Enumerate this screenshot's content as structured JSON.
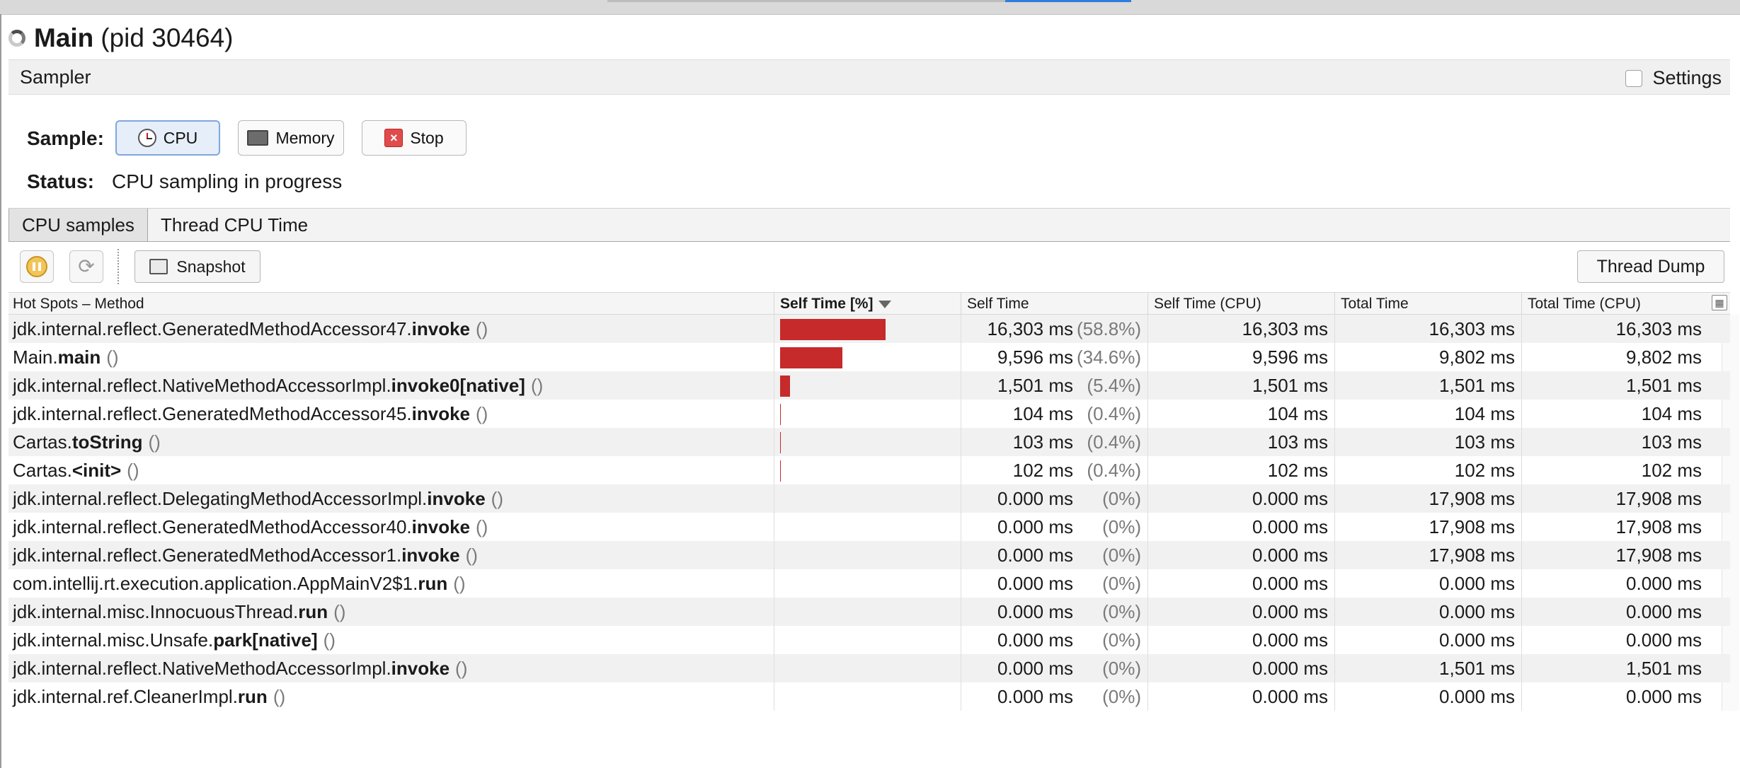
{
  "title": {
    "name": "Main",
    "pid": "(pid 30464)"
  },
  "sampler": {
    "label": "Sampler",
    "settings_label": "Settings"
  },
  "sample": {
    "label": "Sample:",
    "buttons": {
      "cpu": "CPU",
      "memory": "Memory",
      "stop": "Stop"
    },
    "status_label": "Status:",
    "status_value": "CPU sampling in progress"
  },
  "tabs": [
    "CPU samples",
    "Thread CPU Time"
  ],
  "toolbar": {
    "snapshot": "Snapshot",
    "thread_dump": "Thread Dump"
  },
  "table": {
    "columns": [
      "Hot Spots – Method",
      "Self Time [%]",
      "Self Time",
      "Self Time (CPU)",
      "Total Time",
      "Total Time (CPU)"
    ],
    "rows": [
      {
        "prefix": "jdk.internal.reflect.GeneratedMethodAccessor47.",
        "method": "invoke",
        "paren": "()",
        "self_pct": 58.8,
        "self_time": "16,303 ms",
        "pct_label": "(58.8%)",
        "self_cpu": "16,303 ms",
        "total": "16,303 ms",
        "total_cpu": "16,303 ms"
      },
      {
        "prefix": "Main.",
        "method": "main",
        "paren": "()",
        "self_pct": 34.6,
        "self_time": "9,596 ms",
        "pct_label": "(34.6%)",
        "self_cpu": "9,596 ms",
        "total": "9,802 ms",
        "total_cpu": "9,802 ms"
      },
      {
        "prefix": "jdk.internal.reflect.NativeMethodAccessorImpl.",
        "method": "invoke0[native]",
        "paren": "()",
        "self_pct": 5.4,
        "self_time": "1,501 ms",
        "pct_label": "(5.4%)",
        "self_cpu": "1,501 ms",
        "total": "1,501 ms",
        "total_cpu": "1,501 ms"
      },
      {
        "prefix": "jdk.internal.reflect.GeneratedMethodAccessor45.",
        "method": "invoke",
        "paren": "()",
        "self_pct": 0.4,
        "self_time": "104 ms",
        "pct_label": "(0.4%)",
        "self_cpu": "104 ms",
        "total": "104 ms",
        "total_cpu": "104 ms"
      },
      {
        "prefix": "Cartas.",
        "method": "toString",
        "paren": "()",
        "self_pct": 0.4,
        "self_time": "103 ms",
        "pct_label": "(0.4%)",
        "self_cpu": "103 ms",
        "total": "103 ms",
        "total_cpu": "103 ms"
      },
      {
        "prefix": "Cartas.",
        "method": "<init>",
        "paren": "()",
        "self_pct": 0.4,
        "self_time": "102 ms",
        "pct_label": "(0.4%)",
        "self_cpu": "102 ms",
        "total": "102 ms",
        "total_cpu": "102 ms"
      },
      {
        "prefix": "jdk.internal.reflect.DelegatingMethodAccessorImpl.",
        "method": "invoke",
        "paren": "()",
        "self_pct": 0,
        "self_time": "0.000 ms",
        "pct_label": "(0%)",
        "self_cpu": "0.000 ms",
        "total": "17,908 ms",
        "total_cpu": "17,908 ms"
      },
      {
        "prefix": "jdk.internal.reflect.GeneratedMethodAccessor40.",
        "method": "invoke",
        "paren": "()",
        "self_pct": 0,
        "self_time": "0.000 ms",
        "pct_label": "(0%)",
        "self_cpu": "0.000 ms",
        "total": "17,908 ms",
        "total_cpu": "17,908 ms"
      },
      {
        "prefix": "jdk.internal.reflect.GeneratedMethodAccessor1.",
        "method": "invoke",
        "paren": "()",
        "self_pct": 0,
        "self_time": "0.000 ms",
        "pct_label": "(0%)",
        "self_cpu": "0.000 ms",
        "total": "17,908 ms",
        "total_cpu": "17,908 ms"
      },
      {
        "prefix": "com.intellij.rt.execution.application.AppMainV2$1.",
        "method": "run",
        "paren": "()",
        "self_pct": 0,
        "self_time": "0.000 ms",
        "pct_label": "(0%)",
        "self_cpu": "0.000 ms",
        "total": "0.000 ms",
        "total_cpu": "0.000 ms"
      },
      {
        "prefix": "jdk.internal.misc.InnocuousThread.",
        "method": "run",
        "paren": "()",
        "self_pct": 0,
        "self_time": "0.000 ms",
        "pct_label": "(0%)",
        "self_cpu": "0.000 ms",
        "total": "0.000 ms",
        "total_cpu": "0.000 ms"
      },
      {
        "prefix": "jdk.internal.misc.Unsafe.",
        "method": "park[native]",
        "paren": "()",
        "self_pct": 0,
        "self_time": "0.000 ms",
        "pct_label": "(0%)",
        "self_cpu": "0.000 ms",
        "total": "0.000 ms",
        "total_cpu": "0.000 ms"
      },
      {
        "prefix": "jdk.internal.reflect.NativeMethodAccessorImpl.",
        "method": "invoke",
        "paren": "()",
        "self_pct": 0,
        "self_time": "0.000 ms",
        "pct_label": "(0%)",
        "self_cpu": "0.000 ms",
        "total": "1,501 ms",
        "total_cpu": "1,501 ms"
      },
      {
        "prefix": "jdk.internal.ref.CleanerImpl.",
        "method": "run",
        "paren": "()",
        "self_pct": 0,
        "self_time": "0.000 ms",
        "pct_label": "(0%)",
        "self_cpu": "0.000 ms",
        "total": "0.000 ms",
        "total_cpu": "0.000 ms"
      }
    ]
  },
  "colors": {
    "bar": "#c62a2a",
    "accent": "#2f7de1",
    "selected_button": "#e6eef9"
  },
  "icons": [
    "loading-spinner-icon",
    "clock-icon",
    "memory-chip-icon",
    "stop-icon",
    "pause-icon",
    "refresh-icon",
    "snapshot-icon",
    "column-selector-icon",
    "sort-descending-icon"
  ]
}
